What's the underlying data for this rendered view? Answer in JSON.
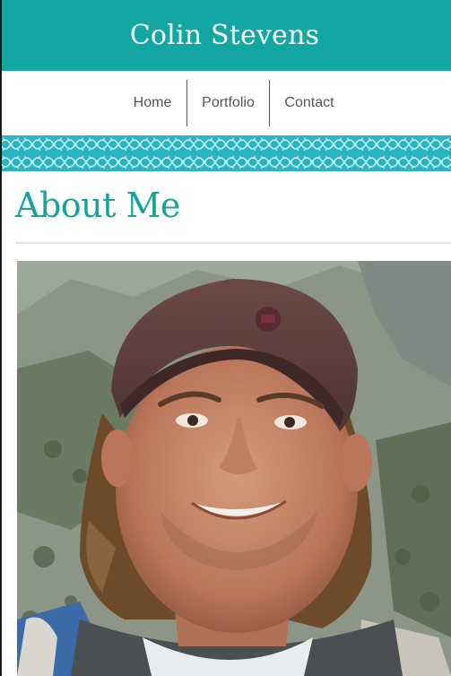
{
  "header": {
    "title": "Colin Stevens"
  },
  "nav": {
    "items": [
      {
        "label": "Home"
      },
      {
        "label": "Portfolio"
      },
      {
        "label": "Contact"
      }
    ]
  },
  "main": {
    "title": "About Me",
    "photo_icon": "profile-photo"
  },
  "colors": {
    "brand": "#12a7a2",
    "pattern": "#2ab4c3",
    "title": "#15a49c",
    "nav_text": "#555555"
  }
}
